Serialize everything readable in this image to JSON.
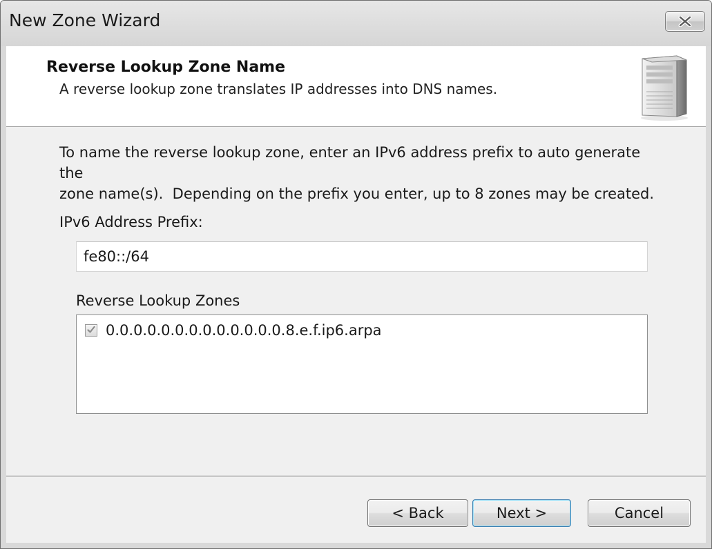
{
  "window": {
    "title": "New Zone Wizard",
    "close_icon": "close-icon"
  },
  "header": {
    "title": "Reverse Lookup Zone Name",
    "subtitle": "A reverse lookup zone translates IP addresses into DNS names.",
    "icon": "server-icon"
  },
  "body": {
    "instructions_line1": "To name the reverse lookup zone, enter an IPv6 address prefix to auto generate the",
    "instructions_line2": "zone name(s).  Depending on the prefix you enter, up to 8 zones may be created.",
    "prefix_label": "IPv6 Address Prefix:",
    "prefix_value": "fe80::/64",
    "zones_label": "Reverse Lookup Zones",
    "zones": [
      {
        "name": "0.0.0.0.0.0.0.0.0.0.0.0.0.8.e.f.ip6.arpa",
        "checked": true
      }
    ]
  },
  "footer": {
    "back_label": "< Back",
    "next_label": "Next >",
    "cancel_label": "Cancel"
  }
}
